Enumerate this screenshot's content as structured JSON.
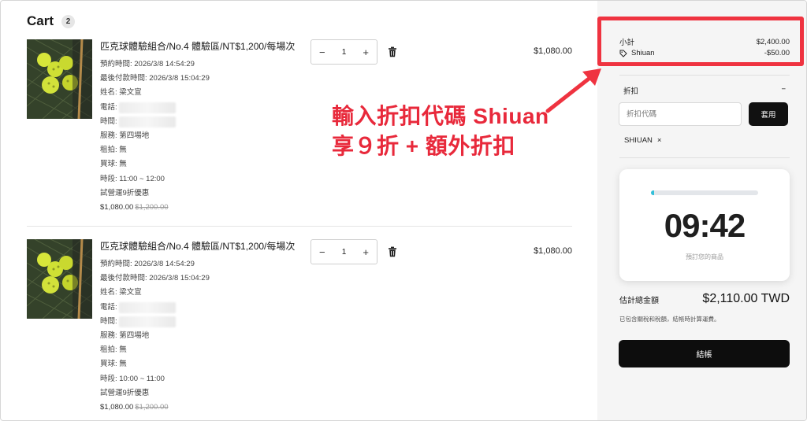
{
  "cart": {
    "title": "Cart",
    "count": "2"
  },
  "items": [
    {
      "title": "匹克球體驗組合/No.4 體驗區/NT$1,200/每場次",
      "booking_time": "預約時間: 2026/3/8 14:54:29",
      "pay_deadline": "最後付款時間: 2026/3/8 15:04:29",
      "name": "姓名: 梁文宣",
      "phone_label": "電話:",
      "time_label": "時間:",
      "service": "服務: 第四場地",
      "rental": "租拍: 無",
      "balls": "買球: 無",
      "slot": "時段: 11:00 ~ 12:00",
      "promo": "試營運9折優惠",
      "price": "$1,080.00",
      "original_price": "$1,200.00",
      "qty": "1",
      "line_total": "$1,080.00"
    },
    {
      "title": "匹克球體驗組合/No.4 體驗區/NT$1,200/每場次",
      "booking_time": "預約時間: 2026/3/8 14:54:29",
      "pay_deadline": "最後付款時間: 2026/3/8 15:04:29",
      "name": "姓名: 梁文宣",
      "phone_label": "電話:",
      "time_label": "時間:",
      "service": "服務: 第四場地",
      "rental": "租拍: 無",
      "balls": "買球: 無",
      "slot": "時段: 10:00 ~ 11:00",
      "promo": "試營運9折優惠",
      "price": "$1,080.00",
      "original_price": "$1,200.00",
      "qty": "1",
      "line_total": "$1,080.00"
    }
  ],
  "qty_controls": {
    "minus": "−",
    "plus": "+"
  },
  "annotation": {
    "line1": "輸入折扣代碼 Shiuan",
    "line2": "享９折 + 額外折扣"
  },
  "summary": {
    "subtotal_label": "小計",
    "subtotal_value": "$2,400.00",
    "discount_code": "Shiuan",
    "discount_value": "-$50.00",
    "discount_section": "折扣",
    "collapse_symbol": "−",
    "code_placeholder": "折扣代碼",
    "apply_label": "套用",
    "applied_tag": "SHIUAN",
    "remove_symbol": "×",
    "timer": "09:42",
    "timer_caption": "預訂您的商品",
    "timer_progress": 0.03,
    "total_label": "估計總金額",
    "total_value": "$2,110.00 TWD",
    "tax_note": "已包含關稅和稅額，結帳時計算運費。",
    "checkout_label": "結帳"
  },
  "colors": {
    "accent_red": "#ef3340",
    "progress": "#33bfd9",
    "button_dark": "#0d0d0d"
  },
  "icons": [
    "trash-icon",
    "tag-icon",
    "close-icon",
    "minus-icon",
    "plus-icon",
    "pickleball-image"
  ]
}
